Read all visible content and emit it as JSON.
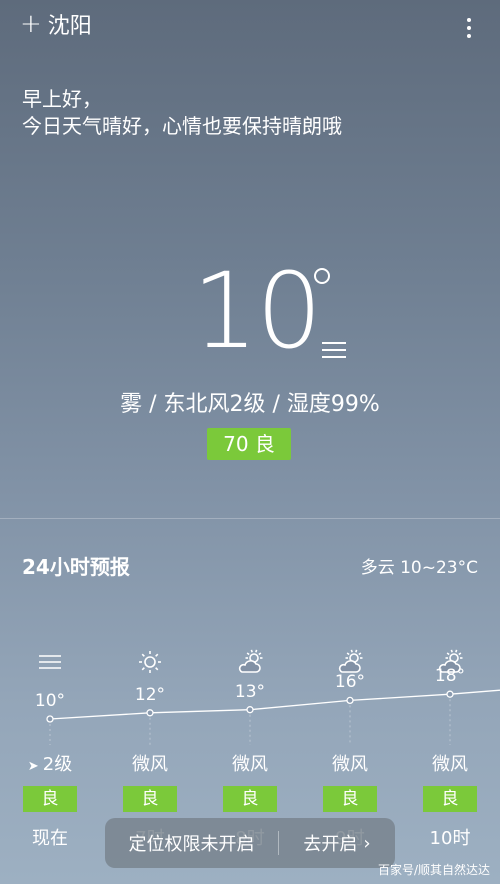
{
  "header": {
    "city": "沈阳",
    "add_icon": "plus-icon",
    "menu_icon": "more-vertical-icon"
  },
  "greeting": {
    "line1": "早上好，",
    "line2": "今日天气晴好，心情也要保持晴朗哦"
  },
  "current": {
    "temperature": "10",
    "condition": "雾 / 东北风2级 / 湿度99%",
    "aqi": "70 良",
    "aqi_color": "#7bc93a"
  },
  "forecast": {
    "title": "24小时预报",
    "range": "多云 10~23°C",
    "hours": [
      {
        "icon": "fog-icon",
        "temp": "10°",
        "temp_value": 10,
        "wind": "2级",
        "quality": "良",
        "time": "现在"
      },
      {
        "icon": "sun-icon",
        "temp": "12°",
        "temp_value": 12,
        "wind": "微风",
        "quality": "良",
        "time": "7时"
      },
      {
        "icon": "partly-cloudy-icon",
        "temp": "13°",
        "temp_value": 13,
        "wind": "微风",
        "quality": "良",
        "time": "8时"
      },
      {
        "icon": "partly-cloudy-icon",
        "temp": "16°",
        "temp_value": 16,
        "wind": "微风",
        "quality": "良",
        "time": "9时"
      },
      {
        "icon": "partly-cloudy-icon",
        "temp": "18°",
        "temp_value": 18,
        "wind": "微风",
        "quality": "良",
        "time": "10时"
      }
    ]
  },
  "toast": {
    "message": "定位权限未开启",
    "action": "去开启"
  },
  "watermark": "百家号/顺其自然达达"
}
